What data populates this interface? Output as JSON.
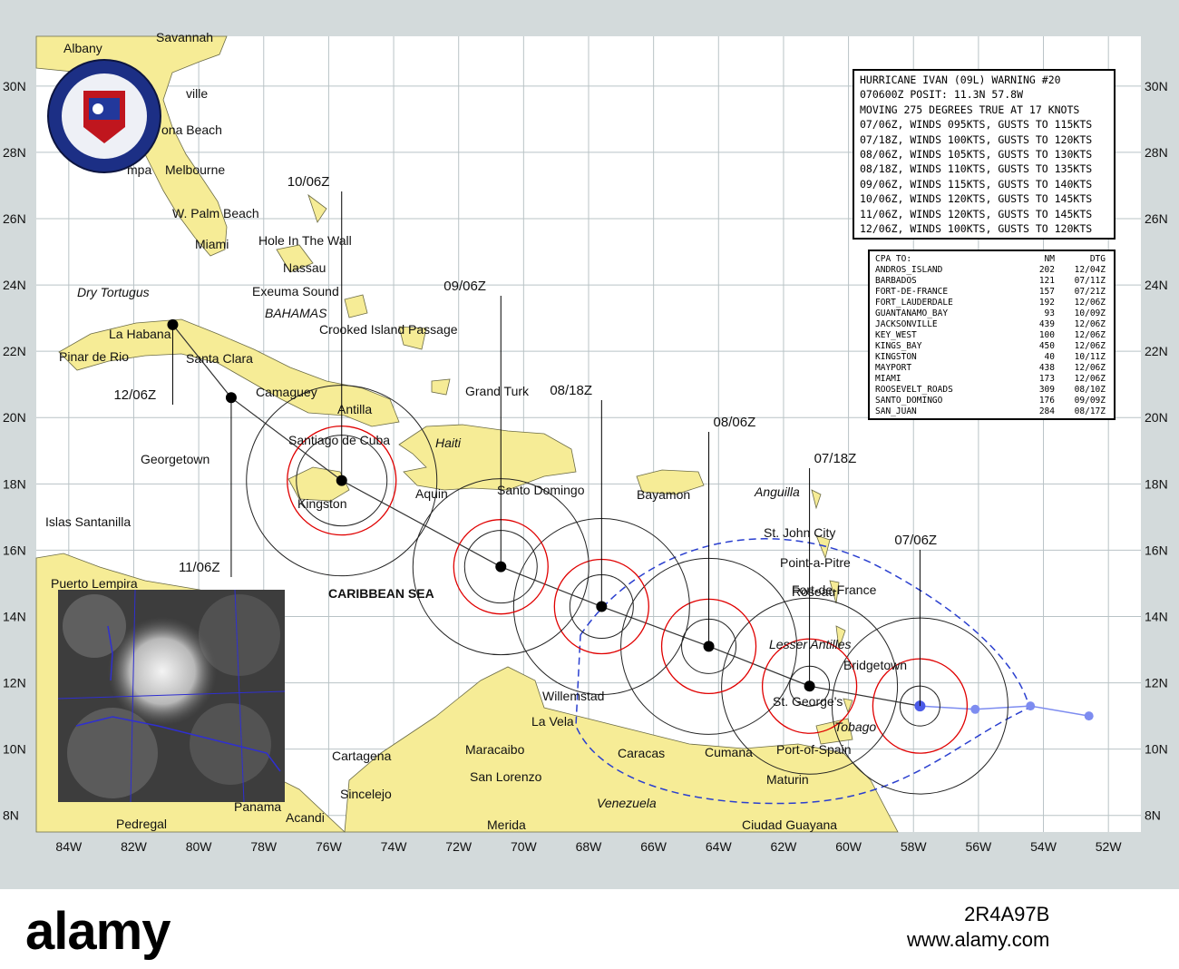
{
  "map": {
    "lat_labels": [
      "30N",
      "28N",
      "26N",
      "24N",
      "22N",
      "20N",
      "18N",
      "16N",
      "14N",
      "12N",
      "10N",
      "8N"
    ],
    "lon_labels": [
      "84W",
      "82W",
      "80W",
      "78W",
      "76W",
      "74W",
      "72W",
      "70W",
      "68W",
      "66W",
      "64W",
      "62W",
      "60W",
      "58W",
      "56W",
      "54W",
      "52W"
    ],
    "places": [
      {
        "text": "Albany"
      },
      {
        "text": "Savannah"
      },
      {
        "text": "ville"
      },
      {
        "text": "ona Beach"
      },
      {
        "text": "mpa"
      },
      {
        "text": "Melbourne"
      },
      {
        "text": "W. Palm Beach"
      },
      {
        "text": "Miami"
      },
      {
        "text": "Hole In The Wall"
      },
      {
        "text": "Nassau"
      },
      {
        "text": "Exeuma Sound"
      },
      {
        "text": "BAHAMAS"
      },
      {
        "text": "Dry Tortugus"
      },
      {
        "text": "Crooked Island Passage"
      },
      {
        "text": "La Habana"
      },
      {
        "text": "Pinar de Rio"
      },
      {
        "text": "Santa Clara"
      },
      {
        "text": "Camaguey"
      },
      {
        "text": "Grand Turk"
      },
      {
        "text": "Antilla"
      },
      {
        "text": "Santiago de Cuba"
      },
      {
        "text": "Haiti"
      },
      {
        "text": "Georgetown"
      },
      {
        "text": "Kingston"
      },
      {
        "text": "Aquin"
      },
      {
        "text": "Santo Domingo"
      },
      {
        "text": "Bayamon"
      },
      {
        "text": "Anguilla"
      },
      {
        "text": "Islas Santanilla"
      },
      {
        "text": "St. John City"
      },
      {
        "text": "Point-a-Pitre"
      },
      {
        "text": "Puerto Lempira"
      },
      {
        "text": "CARIBBEAN SEA"
      },
      {
        "text": "Roseau"
      },
      {
        "text": "Fort-de-France"
      },
      {
        "text": "Lesser Antilles"
      },
      {
        "text": "Bridgetown"
      },
      {
        "text": "Willemstad"
      },
      {
        "text": "St. George's"
      },
      {
        "text": "La Vela"
      },
      {
        "text": "Tobago"
      },
      {
        "text": "Cartagena"
      },
      {
        "text": "Maracaibo"
      },
      {
        "text": "Caracas"
      },
      {
        "text": "Cumana"
      },
      {
        "text": "Port-of-Spain"
      },
      {
        "text": "San Lorenzo"
      },
      {
        "text": "Maturin"
      },
      {
        "text": "Sincelejo"
      },
      {
        "text": "Venezuela"
      },
      {
        "text": "Panama"
      },
      {
        "text": "Acandi"
      },
      {
        "text": "Pedregal"
      },
      {
        "text": "Merida"
      },
      {
        "text": "Ciudad Guayana"
      }
    ],
    "track": [
      {
        "dtg": "07/06Z",
        "lat": 11.3,
        "lon": -57.8
      },
      {
        "dtg": "07/18Z",
        "lat": 11.9,
        "lon": -61.2
      },
      {
        "dtg": "08/06Z",
        "lat": 13.1,
        "lon": -64.3
      },
      {
        "dtg": "08/18Z",
        "lat": 14.3,
        "lon": -67.6
      },
      {
        "dtg": "09/06Z",
        "lat": 15.5,
        "lon": -70.7
      },
      {
        "dtg": "10/06Z",
        "lat": 18.1,
        "lon": -75.6
      },
      {
        "dtg": "11/06Z",
        "lat": 20.6,
        "lon": -79.0
      },
      {
        "dtg": "12/06Z",
        "lat": 22.8,
        "lon": -80.8
      }
    ],
    "past_track": [
      {
        "lat": 11.2,
        "lon": -56.1
      },
      {
        "lat": 11.3,
        "lon": -54.4
      },
      {
        "lat": 11.0,
        "lon": -52.6
      }
    ],
    "colors": {
      "land": "#f6ec96",
      "water": "#ffffff",
      "grid": "#b9c3c6",
      "track": "#000000",
      "wind_ring": "#e00000",
      "swath": "#2a3fcf",
      "past_track": "#7d8cf0"
    }
  },
  "warning": {
    "lines": [
      "HURRICANE IVAN (09L) WARNING #20",
      "070600Z POSIT: 11.3N 57.8W",
      "MOVING 275 DEGREES TRUE AT 17 KNOTS",
      "07/06Z, WINDS 095KTS, GUSTS TO 115KTS",
      "07/18Z, WINDS 100KTS, GUSTS TO 120KTS",
      "08/06Z, WINDS 105KTS, GUSTS TO 130KTS",
      "08/18Z, WINDS 110KTS, GUSTS TO 135KTS",
      "09/06Z, WINDS 115KTS, GUSTS TO 140KTS",
      "10/06Z, WINDS 120KTS, GUSTS TO 145KTS",
      "11/06Z, WINDS 120KTS, GUSTS TO 145KTS",
      "12/06Z, WINDS 100KTS, GUSTS TO 120KTS"
    ]
  },
  "cpa": {
    "header": [
      "CPA TO:",
      "NM",
      "DTG"
    ],
    "rows": [
      [
        "ANDROS_ISLAND",
        "202",
        "12/04Z"
      ],
      [
        "BARBADOS",
        "121",
        "07/11Z"
      ],
      [
        "FORT-DE-FRANCE",
        "157",
        "07/21Z"
      ],
      [
        "FORT_LAUDERDALE",
        "192",
        "12/06Z"
      ],
      [
        "GUANTANAMO_BAY",
        "93",
        "10/09Z"
      ],
      [
        "JACKSONVILLE",
        "439",
        "12/06Z"
      ],
      [
        "KEY_WEST",
        "100",
        "12/06Z"
      ],
      [
        "KINGS_BAY",
        "450",
        "12/06Z"
      ],
      [
        "KINGSTON",
        "40",
        "10/11Z"
      ],
      [
        "MAYPORT",
        "438",
        "12/06Z"
      ],
      [
        "MIAMI",
        "173",
        "12/06Z"
      ],
      [
        "ROOSEVELT_ROADS",
        "309",
        "08/10Z"
      ],
      [
        "SANTO_DOMINGO",
        "176",
        "09/09Z"
      ],
      [
        "SAN_JUAN",
        "284",
        "08/17Z"
      ]
    ]
  },
  "watermark": {
    "brand": "alamy",
    "code": "2R4A97B",
    "url": "www.alamy.com"
  }
}
